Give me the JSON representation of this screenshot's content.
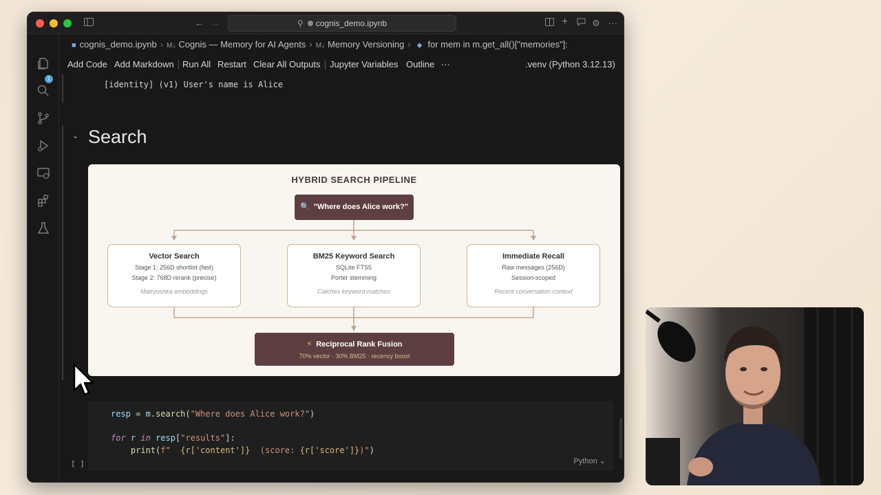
{
  "window": {
    "search_text": "cognis_demo.ipynb"
  },
  "breadcrumb": {
    "file": "cognis_demo.ipynb",
    "section1": "Cognis — Memory for AI Agents",
    "section2": "Memory Versioning",
    "cell": "for mem in m.get_all()[\"memories\"]:"
  },
  "toolbar": {
    "add_code": "Add Code",
    "add_markdown": "Add Markdown",
    "run_all": "Run All",
    "restart": "Restart",
    "clear_outputs": "Clear All Outputs",
    "jupyter_variables": "Jupyter Variables",
    "outline": "Outline",
    "more": "···",
    "kernel": ".venv (Python 3.12.13)"
  },
  "activity_bar": {
    "badge": "1",
    "icons": [
      "explorer-icon",
      "search-icon",
      "source-control-icon",
      "run-debug-icon",
      "remote-explorer-icon",
      "extensions-icon",
      "testing-icon"
    ]
  },
  "output": {
    "line": "[identity] (v1) User's name is Alice"
  },
  "section": {
    "heading": "Search"
  },
  "diagram": {
    "title": "HYBRID SEARCH PIPELINE",
    "query": "\"Where does Alice work?\"",
    "stages": [
      {
        "title": "Vector Search",
        "line1": "Stage 1: 256D shortlist (fast)",
        "line2": "Stage 2: 768D rerank (precise)",
        "note": "Matryoshka embeddings"
      },
      {
        "title": "BM25 Keyword Search",
        "line1": "SQLite FTS5",
        "line2": "Porter stemming",
        "note": "Catches keyword matches"
      },
      {
        "title": "Immediate Recall",
        "line1": "Raw messages (256D)",
        "line2": "Session-scoped",
        "note": "Recent conversation context"
      }
    ],
    "fusion_icon": "⚡",
    "fusion_title": "Reciprocal Rank Fusion",
    "fusion_sub": "70% vector · 30% BM25 · recency boost",
    "colors": {
      "dark_box": "#5d3f42",
      "border": "#d2b48c",
      "connector": "#c2a38c"
    }
  },
  "code_cell": {
    "line1_var": "resp",
    "line1_eq": " = ",
    "line1_obj": "m",
    "line1_dot": ".",
    "line1_fn": "search",
    "line1_open": "(",
    "line1_str": "\"Where does Alice work?\"",
    "line1_close": ")",
    "line3_for": "for",
    "line3_r": " r ",
    "line3_in": "in",
    "line3_resp": " resp",
    "line3_open": "[",
    "line3_key": "\"results\"",
    "line3_close": "]:",
    "line4_indent": "    ",
    "line4_print": "print",
    "line4_open": "(",
    "line4_f": "f\"  ",
    "line4_b1": "{r['content']}",
    "line4_mid": "  (score: ",
    "line4_b2": "{r['score']}",
    "line4_end": ")\"",
    "line4_close": ")",
    "language": "Python ⌄",
    "exec_count": "[ ]"
  }
}
